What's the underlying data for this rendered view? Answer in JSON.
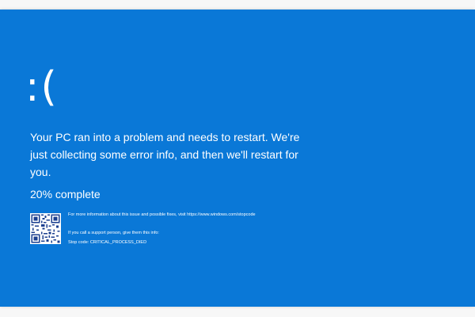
{
  "screen": {
    "background_color": "#0a78d7",
    "text_color": "#ffffff",
    "sad_face": ":(",
    "message": "Your PC ran into a problem and needs to restart. We're just collecting some error info, and then we'll restart for you.",
    "progress_text": "20% complete",
    "progress_percent": 20,
    "qr_icon": "qr-code",
    "more_info_text": "For more information about this issue and possible fixes, visit https://www.windows.com/stopcode",
    "support_text": "If you call a support person, give them this info:",
    "stop_code_text": "Stop code: CRITICAL_PROCESS_DIED"
  }
}
